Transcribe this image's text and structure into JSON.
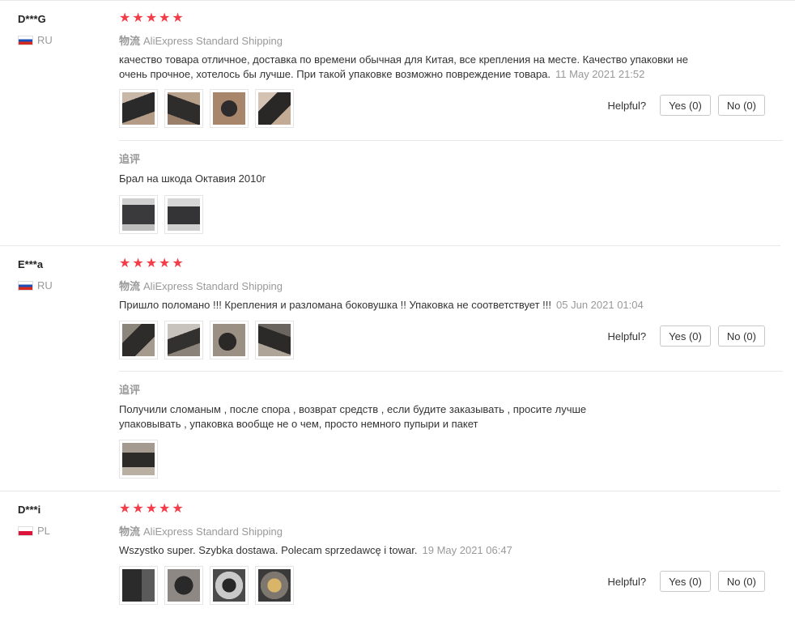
{
  "colors": {
    "star": "#f33e4a",
    "muted": "#999999",
    "border": "#e8e8e8"
  },
  "helpful_label": "Helpful?",
  "reviews": [
    {
      "user": "D***G",
      "country": "RU",
      "flag": "flag-ru",
      "stars": 5,
      "shipping_label": "物流",
      "shipping_method": "AliExpress Standard Shipping",
      "text": "качество товара отличное, доставка по времени обычная для Китая, все крепления на месте. Качество упаковки не очень прочное, хотелось бы лучше. При такой упаковке возможно повреждение товара.",
      "date": "11 May 2021 21:52",
      "photo_count": 4,
      "yes_label": "Yes (0)",
      "no_label": "No (0)",
      "followup_label": "追评",
      "followup_text": "Брал на шкода Октавия 2010г",
      "followup_photo_count": 2
    },
    {
      "user": "E***a",
      "country": "RU",
      "flag": "flag-ru",
      "stars": 5,
      "shipping_label": "物流",
      "shipping_method": "AliExpress Standard Shipping",
      "text": "Пришло поломано !!! Крепления и разломана боковушка !! Упаковка не соответствует !!!",
      "date": "05 Jun 2021 01:04",
      "photo_count": 4,
      "yes_label": "Yes (0)",
      "no_label": "No (0)",
      "followup_label": "追评",
      "followup_text": "Получили сломаным , после спора , возврат средств , если будите заказывать , просите лучше упаковывать , упаковка вообще не о чем, просто немного пупыри и пакет",
      "followup_photo_count": 1
    },
    {
      "user": "D***i",
      "country": "PL",
      "flag": "flag-pl",
      "stars": 5,
      "shipping_label": "物流",
      "shipping_method": "AliExpress Standard Shipping",
      "text": "Wszystko super. Szybka dostawa. Polecam sprzedawcę i towar.",
      "date": "19 May 2021 06:47",
      "photo_count": 4,
      "yes_label": "Yes (0)",
      "no_label": "No (0)"
    }
  ]
}
